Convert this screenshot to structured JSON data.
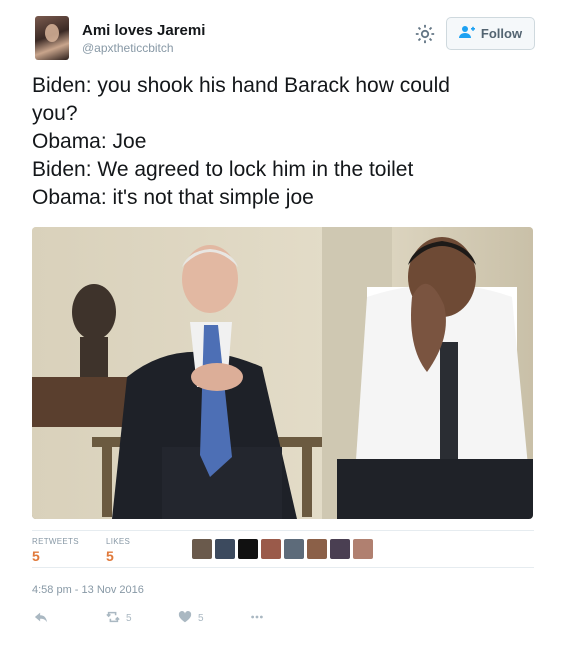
{
  "user": {
    "display_name": "Ami loves Jaremi",
    "handle": "@apxtheticcbitch"
  },
  "follow_label": "Follow",
  "tweet": {
    "lines": [
      "Biden: you shook his hand Barack how could",
      "you?",
      "Obama: Joe",
      "Biden: We agreed to lock him in the toilet",
      "Obama: it's not that simple joe"
    ]
  },
  "stats": {
    "retweets_label": "RETWEETS",
    "retweets_value": "5",
    "likes_label": "LIKES",
    "likes_value": "5"
  },
  "timestamp": "4:58 pm - 13 Nov 2016",
  "actions": {
    "retweet_count": "5",
    "like_count": "5"
  },
  "colors": {
    "accent": "#e0793b",
    "muted": "#8899a6",
    "text": "#14171a"
  },
  "icons": [
    "gear-icon",
    "add-user-icon",
    "reply-icon",
    "retweet-icon",
    "heart-icon",
    "more-icon"
  ]
}
